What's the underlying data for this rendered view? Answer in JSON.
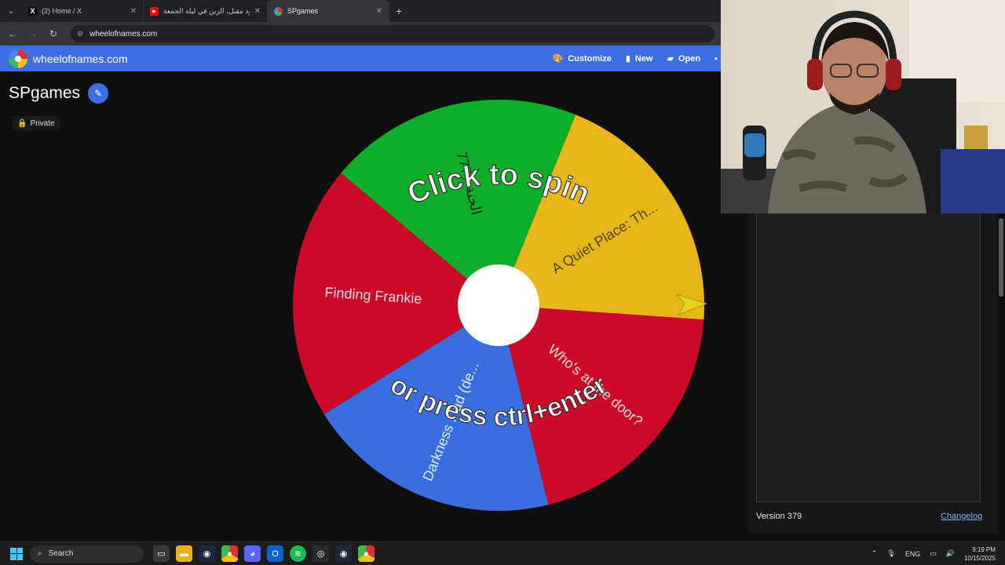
{
  "browser": {
    "tabs": [
      {
        "label": "(2) Home / X",
        "favicon": "x-icon"
      },
      {
        "label": "سعود مقبل، الزين في ليلة الجمعة",
        "favicon": "youtube-icon"
      },
      {
        "label": "SPgames",
        "favicon": "wheel-icon",
        "active": true
      }
    ],
    "url": "wheelofnames.com"
  },
  "site": {
    "brand": "wheelofnames.com",
    "menu": {
      "customize": "Customize",
      "new": "New",
      "open": "Open"
    }
  },
  "wheel": {
    "title": "SPgames",
    "visibility": "Private",
    "prompt_line1": "Click to spin",
    "prompt_line2": "or press ctrl+enter",
    "entries": [
      {
        "label": "A Quiet Place: Th...",
        "color": "#e8b617"
      },
      {
        "label": "Who's at the door?",
        "color": "#cc0a28"
      },
      {
        "label": "Darkness ...ad (de...",
        "color": "#3a6de0"
      },
      {
        "label": "Finding Frankie",
        "color": "#cc0a28"
      },
      {
        "label": "الجنة 7777",
        "color": "#0fae28"
      }
    ]
  },
  "panel": {
    "version": "Version 379",
    "changelog": "Changelog"
  },
  "taskbar": {
    "search": "Search",
    "lang": "ENG",
    "time": "9:19 PM",
    "date": "10/15/2025"
  },
  "colors": {
    "accent": "#3d6ee4",
    "wheel_green": "#0fae28",
    "wheel_yellow": "#e8b617",
    "wheel_red": "#cc0a28",
    "wheel_blue": "#3a6de0"
  }
}
